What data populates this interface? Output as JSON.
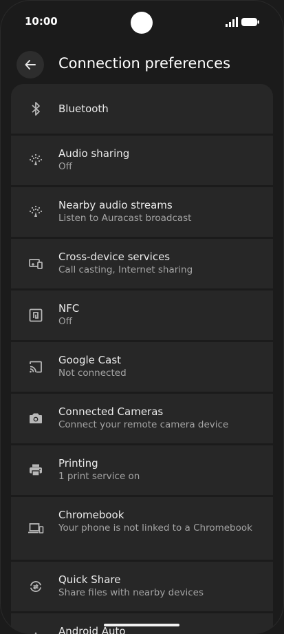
{
  "status_bar": {
    "time": "10:00"
  },
  "header": {
    "title": "Connection preferences"
  },
  "items": [
    {
      "title": "Bluetooth",
      "subtitle": "",
      "icon": "bluetooth-icon"
    },
    {
      "title": "Audio sharing",
      "subtitle": "Off",
      "icon": "audio-sharing-icon"
    },
    {
      "title": "Nearby audio streams",
      "subtitle": "Listen to Auracast broadcast",
      "icon": "audio-streams-icon"
    },
    {
      "title": "Cross-device services",
      "subtitle": "Call casting, Internet sharing",
      "icon": "cross-device-icon"
    },
    {
      "title": "NFC",
      "subtitle": "Off",
      "icon": "nfc-icon"
    },
    {
      "title": "Google Cast",
      "subtitle": "Not connected",
      "icon": "cast-icon"
    },
    {
      "title": "Connected Cameras",
      "subtitle": "Connect your remote camera device",
      "icon": "camera-icon"
    },
    {
      "title": "Printing",
      "subtitle": "1 print service on",
      "icon": "printer-icon"
    },
    {
      "title": "Chromebook",
      "subtitle": "Your phone is not linked to a Chromebook",
      "icon": "chromebook-icon"
    },
    {
      "title": "Quick Share",
      "subtitle": "Share files with nearby devices",
      "icon": "quick-share-icon"
    },
    {
      "title": "Android Auto",
      "subtitle": "",
      "icon": "android-auto-icon"
    }
  ],
  "colors": {
    "background": "#1b1b1b",
    "card": "#272727",
    "primary_text": "#ececec",
    "secondary_text": "#a4a4a4"
  }
}
